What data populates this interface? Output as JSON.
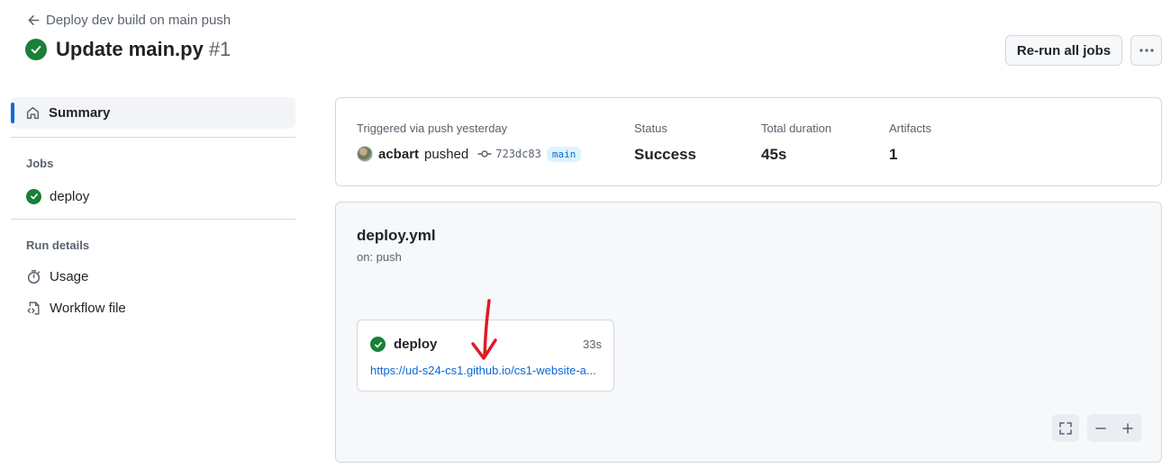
{
  "header": {
    "back_label": "Deploy dev build on main push",
    "title": "Update main.py",
    "run_number": "#1",
    "rerun_label": "Re-run all jobs"
  },
  "sidebar": {
    "summary_label": "Summary",
    "jobs_heading": "Jobs",
    "jobs": [
      {
        "label": "deploy"
      }
    ],
    "run_details_heading": "Run details",
    "details": [
      {
        "label": "Usage"
      },
      {
        "label": "Workflow file"
      }
    ]
  },
  "summary": {
    "trigger_label": "Triggered via push yesterday",
    "actor": "acbart",
    "action": "pushed",
    "commit": "723dc83",
    "branch": "main",
    "status_label": "Status",
    "status_value": "Success",
    "duration_label": "Total duration",
    "duration_value": "45s",
    "artifacts_label": "Artifacts",
    "artifacts_value": "1"
  },
  "workflow": {
    "file": "deploy.yml",
    "trigger": "on: push",
    "job": {
      "name": "deploy",
      "duration": "33s",
      "link": "https://ud-s24-cs1.github.io/cs1-website-a..."
    }
  },
  "colors": {
    "success": "#1a7f37",
    "accent": "#0969da",
    "annotation": "#e01b24"
  }
}
